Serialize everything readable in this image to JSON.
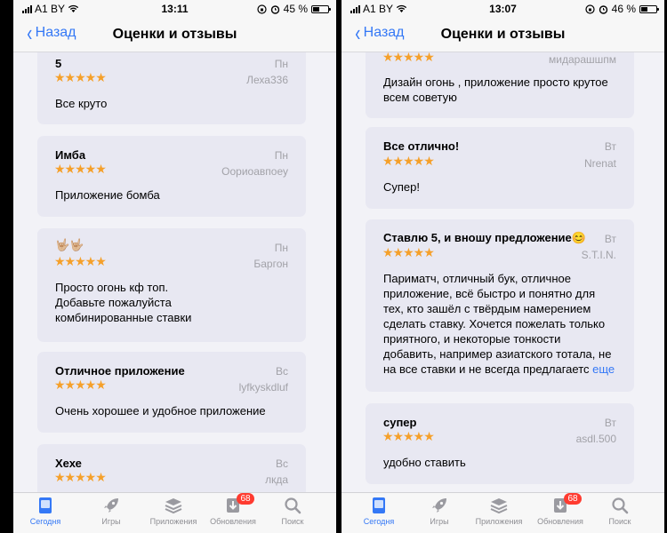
{
  "phones": [
    {
      "status": {
        "carrier": "A1 BY",
        "time": "13:11",
        "battery": "45 %",
        "battery_level": 0.45
      },
      "nav": {
        "back": "Назад",
        "title": "Оценки и отзывы"
      },
      "reviews": [
        {
          "title": "5",
          "day": "Пн",
          "stars": "★★★★★",
          "author": "Леха336",
          "body": "Все круто"
        },
        {
          "title": "Имба",
          "day": "Пн",
          "stars": "★★★★★",
          "author": "Оориоавпоеу",
          "body": "Приложение бомба"
        },
        {
          "title": "🤟🏼🤟🏼",
          "day": "Пн",
          "stars": "★★★★★",
          "author": "Баргон",
          "body": "Просто огонь кф топ.\nДобавьте пожалуйста\nкомбинированные ставки"
        },
        {
          "title": "Отличное приложение",
          "day": "Вс",
          "stars": "★★★★★",
          "author": "lyfkyskdluf",
          "body": "Очень хорошее и удобное приложение"
        },
        {
          "title": "Хехе",
          "day": "Вс",
          "stars": "★★★★★",
          "author": "лкда",
          "body": ""
        }
      ],
      "tabs": [
        {
          "label": "Сегодня",
          "icon": "today-icon"
        },
        {
          "label": "Игры",
          "icon": "rocket-icon"
        },
        {
          "label": "Приложения",
          "icon": "apps-stack-icon"
        },
        {
          "label": "Обновления",
          "icon": "updates-icon",
          "badge": "68"
        },
        {
          "label": "Поиск",
          "icon": "search-icon"
        }
      ]
    },
    {
      "status": {
        "carrier": "A1 BY",
        "time": "13:07",
        "battery": "46 %",
        "battery_level": 0.46
      },
      "nav": {
        "back": "Назад",
        "title": "Оценки и отзывы"
      },
      "reviews": [
        {
          "title": "",
          "day": "",
          "stars": "★★★★★",
          "author": "мидарашшпм",
          "body": "Дизайн огонь , приложение просто крутое\nвсем советую"
        },
        {
          "title": "Все отлично!",
          "day": "Вт",
          "stars": "★★★★★",
          "author": "Nrenat",
          "body": "Супер!"
        },
        {
          "title": "Ставлю 5, и вношу предложение😊",
          "day": "Вт",
          "stars": "★★★★★",
          "author": "S.T.I.N.",
          "body": "Париматч, отличный бук, отличное\nприложение, всё быстро и понятно для\nтех, кто зашёл с твёрдым намерением\nсделать ставку. Хочется пожелать только\nприятного, и некоторые тонкости\nдобавить, например азиатского тотала, не\nна все ставки и не всегда предлагаетс",
          "more": "еще"
        },
        {
          "title": "супер",
          "day": "Вт",
          "stars": "★★★★★",
          "author": "asdl.500",
          "body": "удобно ставить"
        }
      ],
      "tabs": [
        {
          "label": "Сегодня",
          "icon": "today-icon"
        },
        {
          "label": "Игры",
          "icon": "rocket-icon"
        },
        {
          "label": "Приложения",
          "icon": "apps-stack-icon"
        },
        {
          "label": "Обновления",
          "icon": "updates-icon",
          "badge": "68"
        },
        {
          "label": "Поиск",
          "icon": "search-icon"
        }
      ]
    }
  ],
  "colors": {
    "accent": "#3478f6",
    "star": "#f5a02a",
    "badge": "#ff3b30",
    "card": "#e8e8f2"
  }
}
